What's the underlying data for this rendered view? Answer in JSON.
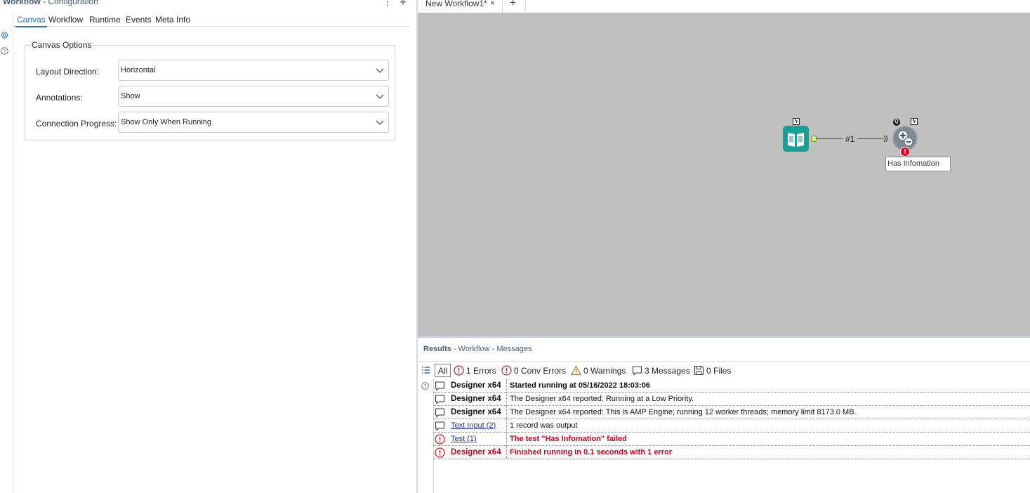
{
  "config_panel": {
    "title": "Workflow",
    "subtitle": "- Configuration",
    "tabs": [
      {
        "label": "Canvas",
        "active": true
      },
      {
        "label": "Workflow",
        "active": false
      },
      {
        "label": "Runtime",
        "active": false
      },
      {
        "label": "Events",
        "active": false
      },
      {
        "label": "Meta Info",
        "active": false
      }
    ],
    "canvas_options": {
      "legend": "Canvas Options",
      "layout_direction": {
        "label": "Layout Direction:",
        "value": "Horizontal"
      },
      "annotations": {
        "label": "Annotations:",
        "value": "Show"
      },
      "connection_progress": {
        "label": "Connection Progress:",
        "value": "Show Only When Running"
      }
    }
  },
  "doc_tabs": {
    "active_tab": "New Workflow1*",
    "close_glyph": "×",
    "add_glyph": "+"
  },
  "canvas": {
    "background_color": "#c0c0c0",
    "connection_label": "#1",
    "annotation": "Has Infomation",
    "tools": [
      {
        "name": "Text Input",
        "icon": "book-icon",
        "color": "#14a196"
      },
      {
        "name": "Test",
        "icon": "test-tool-icon"
      }
    ]
  },
  "results": {
    "title": "Results",
    "subtitle": "- Workflow - Messages",
    "filters": {
      "all": "All",
      "errors": "1 Errors",
      "conv_errors": "0 Conv Errors",
      "warnings": "0 Warnings",
      "messages": "3 Messages",
      "files": "0 Files"
    },
    "messages": [
      {
        "type": "message",
        "source": "Designer x64",
        "source_style": "bold",
        "text": "Started running at 05/16/2022 18:03:06",
        "text_style": "bold"
      },
      {
        "type": "message",
        "source": "Designer x64",
        "source_style": "bold",
        "text": "The Designer x64 reported: Running at a Low Priority.",
        "text_style": "normal"
      },
      {
        "type": "message",
        "source": "Designer x64",
        "source_style": "bold",
        "text": "The Designer x64 reported: This is AMP Engine; running 12 worker threads; memory limit 8173.0 MB.",
        "text_style": "normal"
      },
      {
        "type": "message",
        "source": "Text Input (2)",
        "source_style": "link",
        "text": "1 record was output",
        "text_style": "normal"
      },
      {
        "type": "error",
        "source": "Test (1)",
        "source_style": "link",
        "text": "The test \"Has Infomation\" failed",
        "text_style": "err"
      },
      {
        "type": "error",
        "source": "Designer x64",
        "source_style": "err",
        "text": "Finished running in 0.1 seconds with 1 error",
        "text_style": "err"
      }
    ]
  },
  "colors": {
    "accent": "#2a6cb5",
    "error": "#d0021b",
    "link": "#1a33a8",
    "title_gray": "#4a5b6d"
  }
}
